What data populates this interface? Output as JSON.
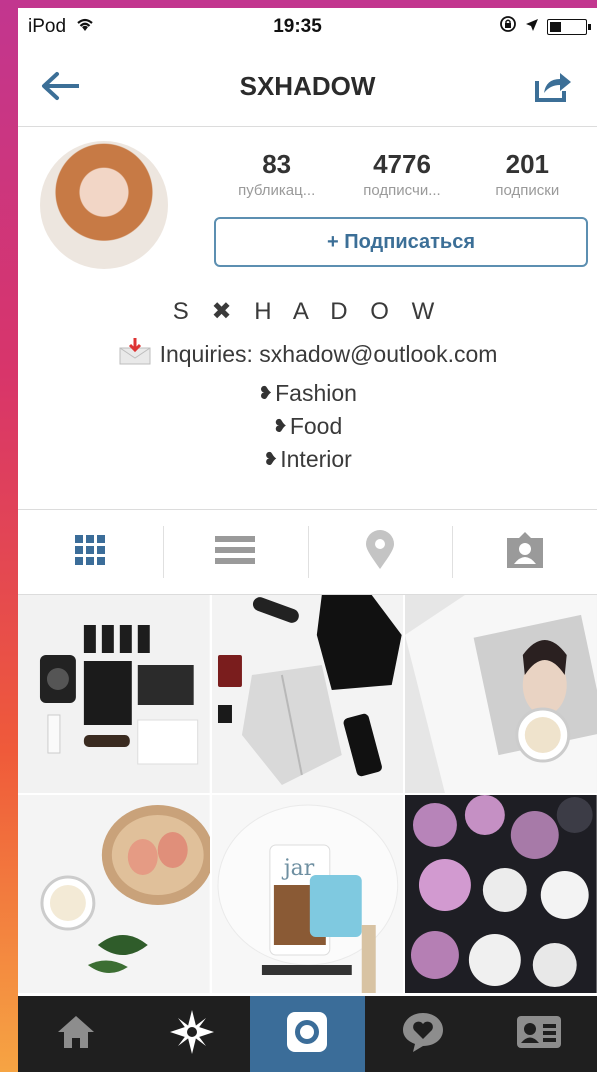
{
  "status_bar": {
    "device": "iPod",
    "time": "19:35"
  },
  "navbar": {
    "title": "SXHADOW",
    "back_icon": "back-arrow-icon",
    "share_icon": "share-icon"
  },
  "profile": {
    "stats": [
      {
        "value": "83",
        "label": "публикац..."
      },
      {
        "value": "4776",
        "label": "подписчи..."
      },
      {
        "value": "201",
        "label": "подписки"
      }
    ],
    "follow_button": "+ Подписаться",
    "bio": {
      "name": "S ✖ H A D O W",
      "email_line": "Inquiries: sxhadow@outlook.com",
      "tags": [
        "Fashion",
        "Food",
        "Interior"
      ]
    }
  },
  "view_tabs": [
    {
      "icon": "grid-icon",
      "active": true
    },
    {
      "icon": "list-icon",
      "active": false
    },
    {
      "icon": "location-pin-icon",
      "active": false
    },
    {
      "icon": "tagged-person-icon",
      "active": false
    }
  ],
  "photos": [
    {
      "name": "photo-flatlay-cosmetics"
    },
    {
      "name": "photo-flatlay-fashion"
    },
    {
      "name": "photo-woman-coffee"
    },
    {
      "name": "photo-eggs-candle"
    },
    {
      "name": "photo-jar-drink"
    },
    {
      "name": "photo-flowers"
    }
  ],
  "bottom_nav": [
    {
      "icon": "home-icon",
      "active": false
    },
    {
      "icon": "explore-icon",
      "active": false
    },
    {
      "icon": "camera-icon",
      "active": true
    },
    {
      "icon": "activity-icon",
      "active": false
    },
    {
      "icon": "profile-icon",
      "active": false
    }
  ],
  "colors": {
    "accent": "#3b6d99",
    "follow_border": "#5c8fb1",
    "background_gradient_top": "#c2368f",
    "background_gradient_bottom": "#f6a443"
  }
}
